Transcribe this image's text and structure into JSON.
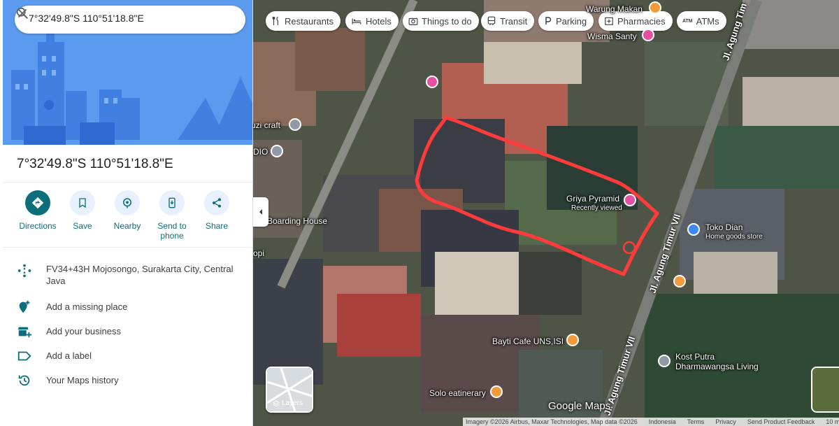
{
  "search": {
    "value": "7°32'49.8\"S 110°51'18.8\"E",
    "search_icon": "search-icon",
    "close_icon": "close-icon"
  },
  "place": {
    "title": "7°32'49.8\"S 110°51'18.8\"E"
  },
  "actions": [
    {
      "label": "Directions",
      "icon": "directions-icon"
    },
    {
      "label": "Save",
      "icon": "bookmark-icon"
    },
    {
      "label": "Nearby",
      "icon": "nearby-icon"
    },
    {
      "label": "Send to phone",
      "icon": "phone-icon"
    },
    {
      "label": "Share",
      "icon": "share-icon"
    }
  ],
  "info_rows": [
    {
      "text": "FV34+43H Mojosongo, Surakarta City, Central Java",
      "icon": "plus-code-icon"
    },
    {
      "text": "Add a missing place",
      "icon": "add-place-icon"
    },
    {
      "text": "Add your business",
      "icon": "business-icon"
    },
    {
      "text": "Add a label",
      "icon": "label-icon"
    },
    {
      "text": "Your Maps history",
      "icon": "history-icon"
    }
  ],
  "chips": [
    {
      "label": "Restaurants",
      "icon": "restaurant-icon"
    },
    {
      "label": "Hotels",
      "icon": "hotel-icon"
    },
    {
      "label": "Things to do",
      "icon": "camera-icon"
    },
    {
      "label": "Transit",
      "icon": "transit-icon"
    },
    {
      "label": "Parking",
      "icon": "parking-icon"
    },
    {
      "label": "Pharmacies",
      "icon": "pharmacy-icon"
    },
    {
      "label": "ATMs",
      "icon": "atm-icon"
    }
  ],
  "map_labels": {
    "warung": "Warung Makan",
    "wisma": "Wisma Santy",
    "uzi": "uzi craft",
    "dio": "DIO",
    "griya": "Griya Pyramid",
    "griya_sub": "Recently viewed",
    "boarding": "Boarding House",
    "opi": "opi",
    "toko": "Toko Dian",
    "toko_sub": "Home goods store",
    "bayti": "Bayti Cafe UNS,ISI",
    "solo": "Solo eatinerary",
    "kost1": "Kost Putra",
    "kost2": "Dharmawangsa Living",
    "road_a": "Jl. Agung Timur VII",
    "road_b": "Jl. Agung Timur VII",
    "road_c": "Jl. Agung Tim",
    "road_d": "Jl. Agung Timur VII"
  },
  "layers": {
    "label": "Layers"
  },
  "brand": "Google Maps",
  "footer": [
    "Imagery ©2026 Airbus, Maxar Technologies, Map data ©2026",
    "Indonesia",
    "Terms",
    "Privacy",
    "Send Product Feedback",
    "10 m"
  ],
  "colors": {
    "accent": "#0b6e7a",
    "drawn_outline": "#ff3b3b",
    "hero_blue": "#5e9cf0"
  }
}
